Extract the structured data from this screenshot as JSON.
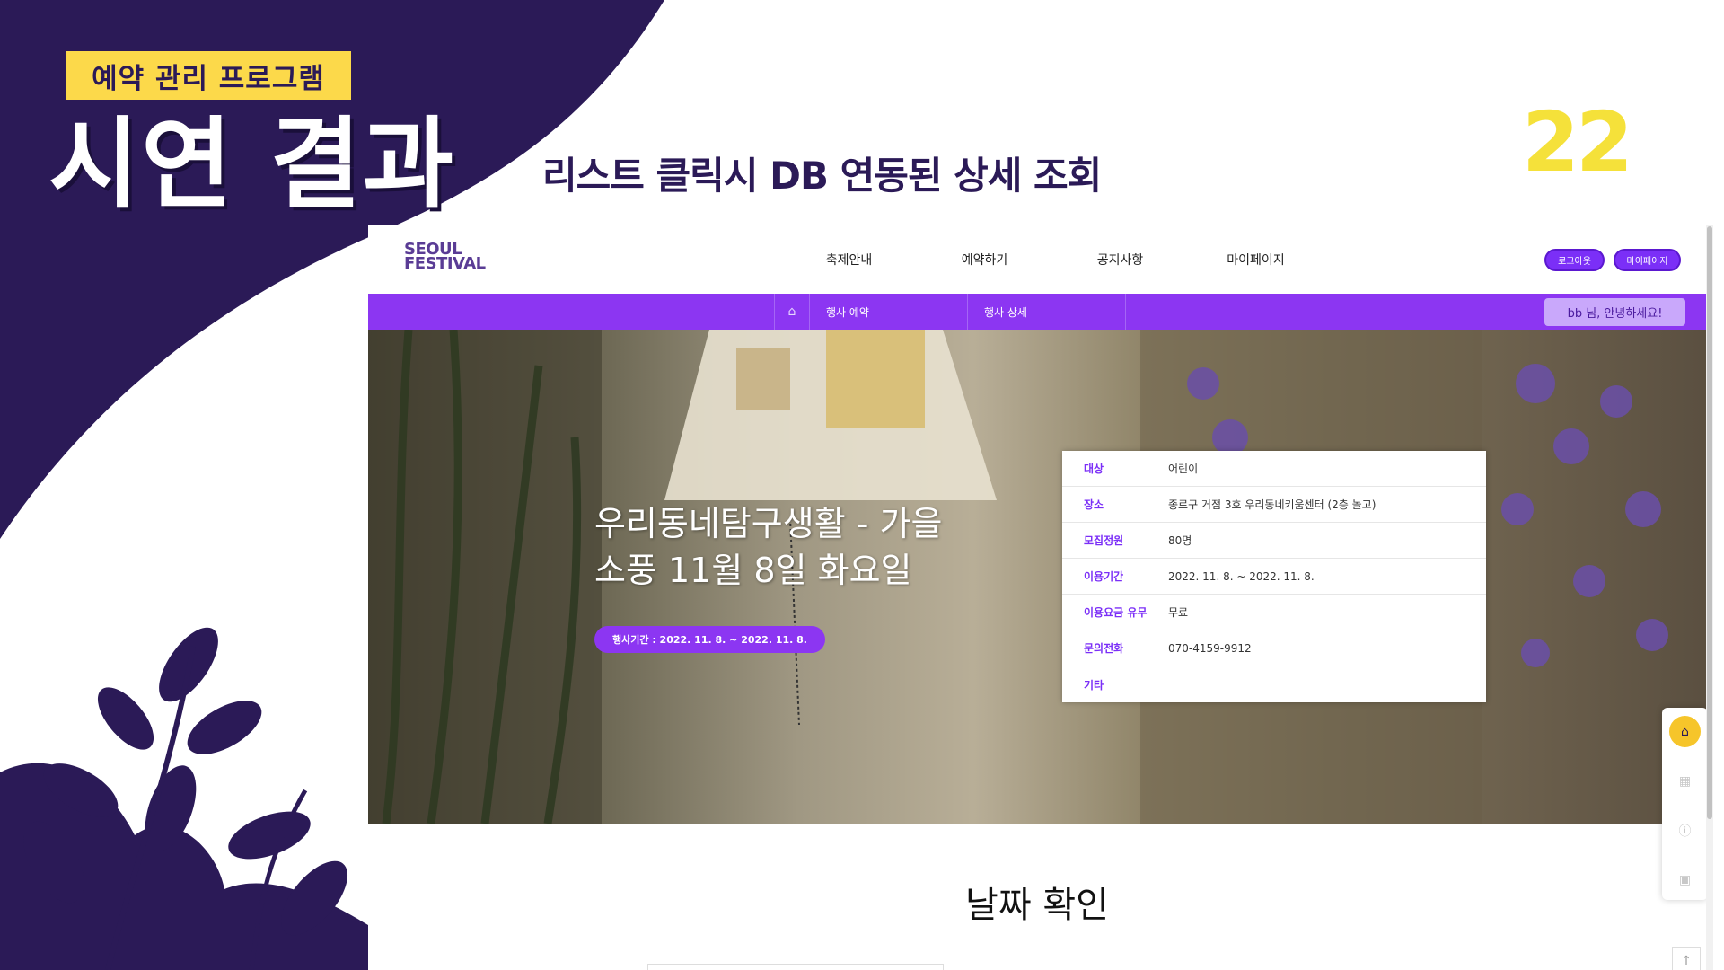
{
  "slide": {
    "tag": "예약 관리 프로그램",
    "title": "시연 결과",
    "subtitle": "리스트 클릭시 DB 연동된 상세 조회",
    "page_number": "22"
  },
  "colors": {
    "navy": "#2b1a57",
    "accent_yellow": "#fcd94a",
    "accent_purple": "#8c36f2"
  },
  "site": {
    "logo_line1": "SEOUL",
    "logo_line2": "FESTIVAL",
    "nav": [
      "축제안내",
      "예약하기",
      "공지사항",
      "마이페이지"
    ],
    "buttons": {
      "logout": "로그아웃",
      "mypage": "마이페이지"
    },
    "breadcrumb": {
      "home_icon": "home-icon",
      "items": [
        "행사 예약",
        "행사 상세"
      ]
    },
    "greeting": "bb 님, 안녕하세요!"
  },
  "event": {
    "title": "우리동네탐구생활 - 가을소풍 11월 8일 화요일",
    "period": "행사기간 : 2022. 11. 8. ~ 2022. 11. 8.",
    "details": [
      {
        "key": "대상",
        "value": "어린이"
      },
      {
        "key": "장소",
        "value": "종로구 거점 3호 우리동네키움센터 (2층 놀고)"
      },
      {
        "key": "모집정원",
        "value": "80명"
      },
      {
        "key": "이용기간",
        "value": "2022. 11. 8. ~ 2022. 11. 8."
      },
      {
        "key": "이용요금 유무",
        "value": "무료"
      },
      {
        "key": "문의전화",
        "value": "070-4159-9912"
      },
      {
        "key": "기타",
        "value": ""
      }
    ]
  },
  "quick_menu": [
    "home-icon",
    "calendar-icon",
    "info-icon",
    "chat-icon"
  ],
  "date_section": {
    "title": "날짜 확인"
  }
}
